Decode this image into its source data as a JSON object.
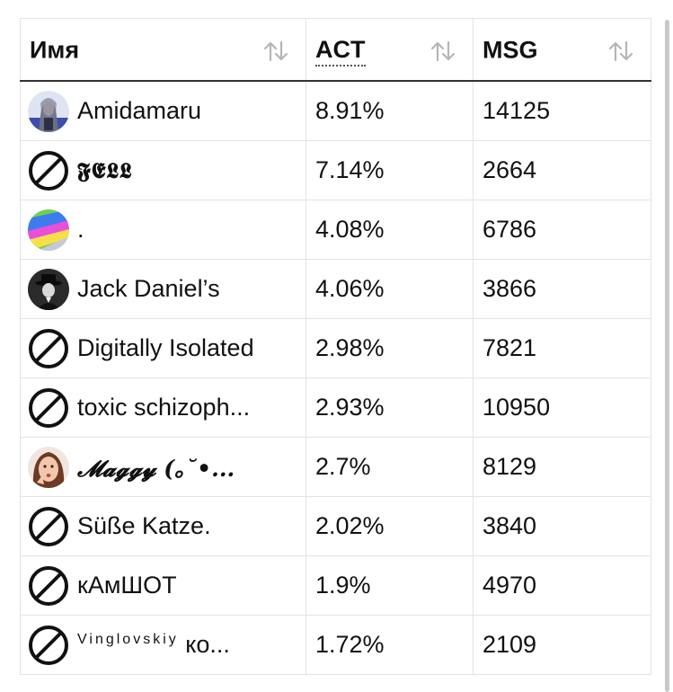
{
  "table": {
    "columns": [
      {
        "label": "Имя",
        "sort_icon": "sort-arrows-icon"
      },
      {
        "label": "ACT",
        "sort_icon": "sort-arrows-icon"
      },
      {
        "label": "MSG",
        "sort_icon": "sort-arrows-icon"
      }
    ],
    "rows": [
      {
        "name": "Amidamaru",
        "avatar": "avatar-anime-character",
        "act": "8.91%",
        "msg": "14125"
      },
      {
        "name": "𝕱𝕰𝕷𝕷",
        "avatar": "no-avatar-icon",
        "act": "7.14%",
        "msg": "2664"
      },
      {
        "name": ".",
        "avatar": "avatar-colorful-abstract",
        "act": "4.08%",
        "msg": "6786"
      },
      {
        "name": "Jack Daniel’s",
        "avatar": "avatar-man-in-hat",
        "act": "4.06%",
        "msg": "3866"
      },
      {
        "name": "Digitally Isolated",
        "avatar": "no-avatar-icon",
        "act": "2.98%",
        "msg": "7821"
      },
      {
        "name": "toxic schizoph...",
        "avatar": "no-avatar-icon",
        "act": "2.93%",
        "msg": "10950"
      },
      {
        "name": "𝓜𝓪𝓰𝓰𝔂 (｡˘•...",
        "avatar": "avatar-woman-face",
        "act": "2.7%",
        "msg": "8129"
      },
      {
        "name": "Süße Katze.",
        "avatar": "no-avatar-icon",
        "act": "2.02%",
        "msg": "3840"
      },
      {
        "name": "кАмШОТ",
        "avatar": "no-avatar-icon",
        "act": "1.9%",
        "msg": "4970"
      },
      {
        "name_small": "Vinglovskiy",
        "name": "ко...",
        "avatar": "no-avatar-icon",
        "act": "1.72%",
        "msg": "2109"
      }
    ]
  }
}
